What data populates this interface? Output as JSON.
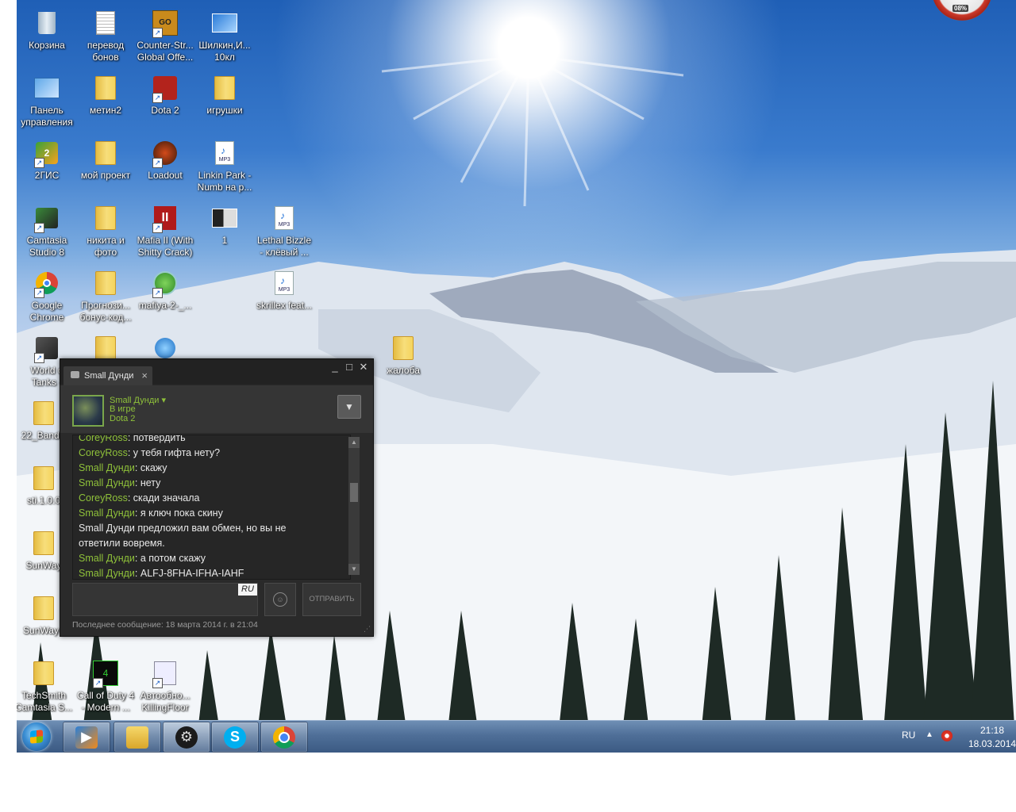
{
  "desktop_icons": [
    {
      "label": "Корзина",
      "icon": "recycle-bin-icon"
    },
    {
      "label": "перевод\nбонов",
      "icon": "text-document-icon"
    },
    {
      "label": "Counter-Str...\nGlobal Offe...",
      "icon": "csgo-icon"
    },
    {
      "label": "Шилкин,И...\n10кл",
      "icon": "image-file-icon"
    },
    {
      "label": "Панель\nуправления",
      "icon": "control-panel-icon"
    },
    {
      "label": "метин2",
      "icon": "folder-icon"
    },
    {
      "label": "Dota 2",
      "icon": "dota2-icon"
    },
    {
      "label": "игрушки",
      "icon": "folder-icon"
    },
    {
      "label": "2ГИС",
      "icon": "2gis-icon"
    },
    {
      "label": "мой проект",
      "icon": "folder-icon"
    },
    {
      "label": "Loadout",
      "icon": "loadout-icon"
    },
    {
      "label": "Linkin Park -\nNumb на р...",
      "icon": "mp3-file-icon"
    },
    {
      "label": "Camtasia\nStudio 8",
      "icon": "camtasia-icon"
    },
    {
      "label": "никита и\nфото",
      "icon": "folder-icon"
    },
    {
      "label": "Mafia II (With\nShitty Crack)",
      "icon": "mafia2-icon"
    },
    {
      "label": "1",
      "icon": "image-file-icon"
    },
    {
      "label": "Lethal Bizzle\n- клёвый ...",
      "icon": "mp3-file-icon"
    },
    {
      "label": "Google\nChrome",
      "icon": "chrome-icon"
    },
    {
      "label": "Прогнози...\nбонус-код...",
      "icon": "folder-icon"
    },
    {
      "label": "mafiya-2-_...",
      "icon": "torrent-icon"
    },
    {
      "label": "skrillex feat...",
      "icon": "mp3-file-icon"
    },
    {
      "label": "World o\nTanks -",
      "icon": "world-of-tanks-icon"
    },
    {
      "label": "",
      "icon": "folder-icon"
    },
    {
      "label": "",
      "icon": "globe-icon"
    },
    {
      "label": "жалоба",
      "icon": "folder-icon"
    },
    {
      "label": "22_Bandic",
      "icon": "folder-icon"
    },
    {
      "label": "sti.1.0.0",
      "icon": "folder-icon"
    },
    {
      "label": "SunWay",
      "icon": "folder-icon"
    },
    {
      "label": "SunWay+",
      "icon": "folder-icon"
    },
    {
      "label": "TechSmith\nCamtasia S...",
      "icon": "folder-icon"
    },
    {
      "label": "Call of Duty 4\n- Modern ...",
      "icon": "cod4-icon"
    },
    {
      "label": "Автообно...\nKillingFloor",
      "icon": "app-shortcut-icon"
    }
  ],
  "chat": {
    "tab_title": "Small Дунди",
    "tab_close": "×",
    "friend": {
      "name": "Small Дунди ▾",
      "status": "В игре",
      "game": "Dota 2"
    },
    "messages": [
      {
        "who": "CoreyRoss",
        "sep": ": ",
        "text": "потвердить"
      },
      {
        "who": "CoreyRoss",
        "sep": ": ",
        "text": "у тебя гифта нету?"
      },
      {
        "who": "Small Дунди",
        "sep": ": ",
        "text": "скажу"
      },
      {
        "who": "Small Дунди",
        "sep": ": ",
        "text": "нету"
      },
      {
        "who": "CoreyRoss",
        "sep": ": ",
        "text": "скади значала"
      },
      {
        "who": "Small Дунди",
        "sep": ": ",
        "text": "я ключ пока скину"
      }
    ],
    "system_message": "Small Дунди предложил вам обмен, но вы не ответили вовремя.",
    "messages_after": [
      {
        "who": "Small Дунди",
        "sep": ": ",
        "text": "а потом скажу"
      },
      {
        "who": "Small Дунди",
        "sep": ": ",
        "text": "ALFJ-8FHA-IFHA-IAHF"
      }
    ],
    "input_value": "",
    "input_lang": "RU",
    "send_label": "ОТПРАВИТЬ",
    "last_message": "Последнее сообщение: 18 марта 2014 г. в 21:04"
  },
  "taskbar": {
    "apps": [
      {
        "name": "media-player",
        "icon": "media-player-icon"
      },
      {
        "name": "explorer",
        "icon": "explorer-icon"
      },
      {
        "name": "steam",
        "icon": "steam-icon"
      },
      {
        "name": "skype",
        "icon": "skype-icon"
      },
      {
        "name": "chrome",
        "icon": "chrome-icon"
      }
    ],
    "lang": "RU",
    "time": "21:18",
    "date": "18.03.2014"
  },
  "gadget": {
    "value": "08%"
  },
  "colors": {
    "steam_green": "#8fc13a",
    "taskbar": "#4f6f98"
  }
}
